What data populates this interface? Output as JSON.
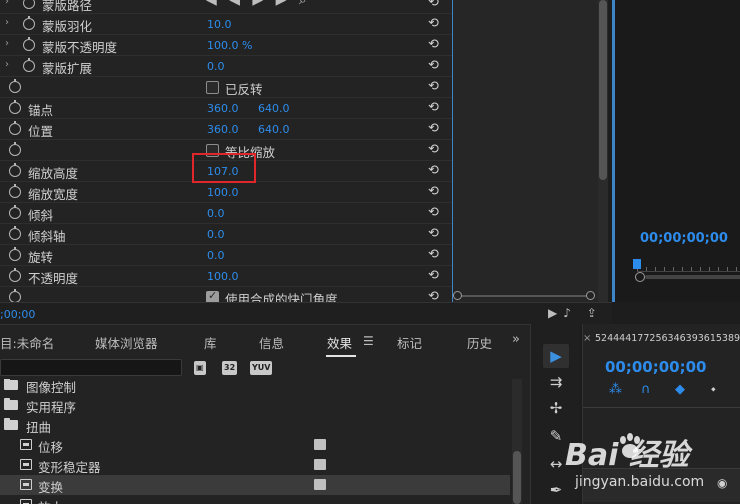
{
  "effect_controls": {
    "properties": [
      {
        "name": "蒙版路径",
        "twirl": "›"
      },
      {
        "name": "蒙版羽化",
        "twirl": "›",
        "v1": "10.0"
      },
      {
        "name": "蒙版不透明度",
        "twirl": "›",
        "v1": "100.0 %"
      },
      {
        "name": "蒙版扩展",
        "twirl": "›",
        "v1": "0.0"
      },
      {
        "checkbox_label": "已反转",
        "checked": false
      },
      {
        "name": "锚点",
        "v1": "360.0",
        "v2": "640.0"
      },
      {
        "name": "位置",
        "v1": "360.0",
        "v2": "640.0"
      },
      {
        "checkbox_label": "等比缩放",
        "checked": false
      },
      {
        "name": "缩放高度",
        "v1": "107.0"
      },
      {
        "name": "缩放宽度",
        "v1": "100.0"
      },
      {
        "name": "倾斜",
        "v1": "0.0"
      },
      {
        "name": "倾斜轴",
        "v1": "0.0"
      },
      {
        "name": "旋转",
        "v1": "0.0"
      },
      {
        "name": "不透明度",
        "v1": "100.0"
      },
      {
        "checkbox_label": "使用合成的快门角度",
        "checked": true
      }
    ],
    "reset_glyph": "⟲",
    "footer_timecode": ";00;00"
  },
  "program_monitor": {
    "timecode": "00;00;00;00"
  },
  "bottom_tabs": [
    {
      "label": "目:未命名"
    },
    {
      "label": "媒体浏览器"
    },
    {
      "label": "库"
    },
    {
      "label": "信息"
    },
    {
      "label": "效果",
      "active": true
    },
    {
      "label": "标记"
    },
    {
      "label": "历史"
    }
  ],
  "filter_badges": [
    "32",
    "YUV"
  ],
  "effects_list": [
    {
      "name": "图像控制",
      "type": "folder"
    },
    {
      "name": "实用程序",
      "type": "folder"
    },
    {
      "name": "扭曲",
      "type": "folder"
    },
    {
      "name": "位移",
      "type": "effect",
      "accel": true
    },
    {
      "name": "变形稳定器",
      "type": "effect",
      "accel": true
    },
    {
      "name": "变换",
      "type": "effect",
      "accel": true,
      "selected": true
    },
    {
      "name": "放大",
      "type": "effect"
    }
  ],
  "timeline": {
    "sequence_name": "524444177256346393615389",
    "timecode": "00;00;00;00"
  },
  "watermark": {
    "logo": "Bai  经验",
    "sub": "jingyan.baidu.com"
  },
  "colors": {
    "accent_blue": "#2d8ceb",
    "highlight_red": "#e0262b",
    "panel_bg": "#232323"
  }
}
